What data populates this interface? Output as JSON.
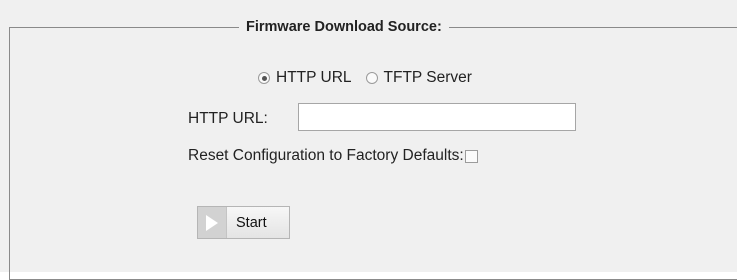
{
  "section": {
    "legend": "Firmware Download Source:"
  },
  "source_options": [
    {
      "label": "HTTP URL",
      "selected": true
    },
    {
      "label": "TFTP Server",
      "selected": false
    }
  ],
  "http_url": {
    "label": "HTTP URL:",
    "value": ""
  },
  "reset": {
    "label": "Reset Configuration to Factory Defaults:",
    "checked": false
  },
  "start_button": {
    "label": "Start",
    "icon": "play-icon"
  },
  "colors": {
    "panel_background": "#f0f0f0",
    "border": "#8a8a8a",
    "play_icon": "#ffffff",
    "play_box": "#d2d2d2"
  }
}
